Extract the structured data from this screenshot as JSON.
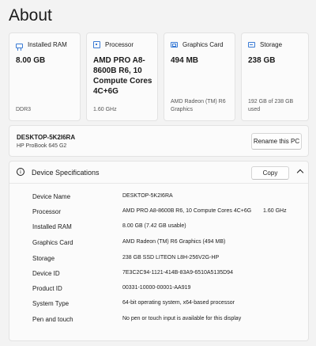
{
  "page": {
    "title": "About"
  },
  "cards": {
    "ram": {
      "label": "Installed RAM",
      "value": "8.00 GB",
      "sub": "DDR3",
      "icon": "ram-icon"
    },
    "processor": {
      "label": "Processor",
      "value": "AMD PRO A8-8600B R6, 10 Compute Cores 4C+6G",
      "sub": "1.60 GHz",
      "icon": "processor-icon"
    },
    "graphics": {
      "label": "Graphics Card",
      "value": "494 MB",
      "sub": "AMD Radeon (TM) R6 Graphics",
      "icon": "graphics-card-icon"
    },
    "storage": {
      "label": "Storage",
      "value": "238 GB",
      "sub": "192 GB of 238 GB used",
      "icon": "storage-icon"
    }
  },
  "device": {
    "name": "DESKTOP-5K2I6RA",
    "model": "HP ProBook 645 G2",
    "rename_label": "Rename this PC"
  },
  "specs": {
    "title": "Device Specifications",
    "copy_label": "Copy",
    "rows": [
      {
        "key": "Device Name",
        "value": "DESKTOP-5K2I6RA"
      },
      {
        "key": "Processor",
        "value": "AMD PRO A8-8600B R6, 10 Compute Cores 4C+6G",
        "extra": "1.60 GHz"
      },
      {
        "key": "Installed RAM",
        "value": "8.00 GB (7.42 GB usable)"
      },
      {
        "key": "Graphics Card",
        "value": "AMD Radeon (TM) R6 Graphics (494 MB)"
      },
      {
        "key": "Storage",
        "value": "238 GB SSD LITEON L8H-256V2G-HP"
      },
      {
        "key": "Device ID",
        "value": "7E3C2C94-1121-414B-83A9-6510A5135D94"
      },
      {
        "key": "Product ID",
        "value": "00331-10000-00001-AA919"
      },
      {
        "key": "System Type",
        "value": "64-bit operating system, x64-based processor"
      },
      {
        "key": "Pen and touch",
        "value": "No pen or touch input is available for this display"
      }
    ]
  },
  "colors": {
    "accent": "#3a7bd5",
    "background": "#f3f3f3",
    "card": "#fbfbfb"
  }
}
